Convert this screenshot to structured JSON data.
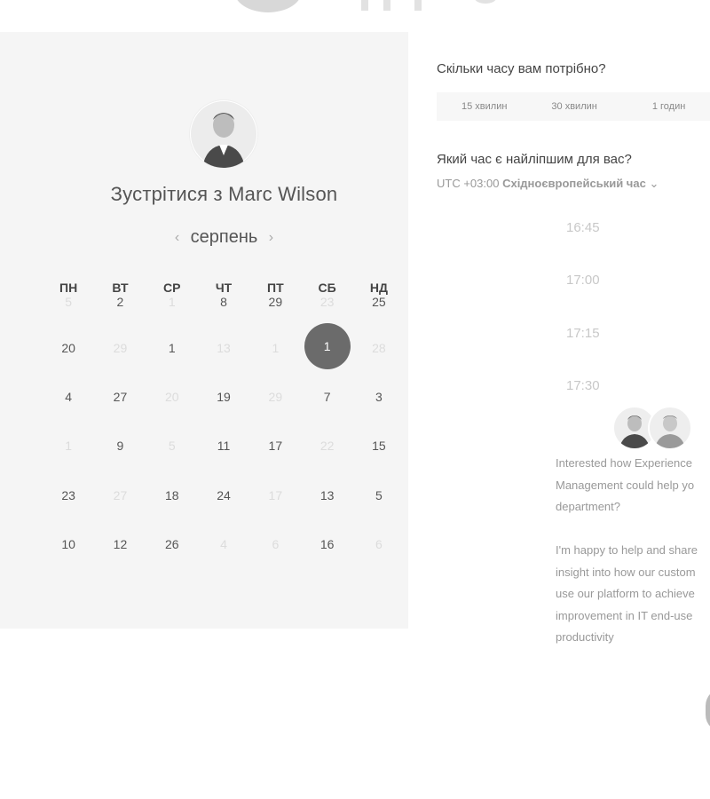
{
  "host": {
    "meet_title": "Зустрітися з Marc Wilson"
  },
  "calendar": {
    "month": "серпень",
    "prev_icon": "chevron-left-icon",
    "next_icon": "chevron-right-icon",
    "weekdays": [
      "ПН",
      "ВТ",
      "СР",
      "ЧТ",
      "ПТ",
      "СБ",
      "НД"
    ],
    "weeks": [
      [
        "5",
        "2",
        "1",
        "8",
        "29",
        "23",
        "25"
      ],
      [
        "20",
        "29",
        "1",
        "13",
        "1",
        "1",
        "28"
      ],
      [
        "4",
        "27",
        "20",
        "19",
        "29",
        "7",
        "3"
      ],
      [
        "1",
        "9",
        "5",
        "11",
        "17",
        "22",
        "15"
      ],
      [
        "23",
        "27",
        "18",
        "24",
        "17",
        "13",
        "5"
      ],
      [
        "10",
        "12",
        "26",
        "4",
        "6",
        "16",
        "6"
      ]
    ]
  },
  "duration": {
    "question": "Скільки часу вам потрібно?",
    "options": [
      "15 хвилин",
      "30 хвилин",
      "1 годин"
    ]
  },
  "time": {
    "question": "Який час є найліпшим для вас?",
    "tz_offset": "UTC +03:00",
    "tz_name": "Східноєвропейський час",
    "tz_chevron": "⌄",
    "slots": [
      "16:45",
      "17:00",
      "17:15",
      "17:30"
    ]
  },
  "chat": {
    "message_1": "Interested how Experience\nManagement could help yo\ndepartment?",
    "message_2": "I'm happy to help and share\ninsight into how our custom\nuse our platform to achieve\nimprovement in IT end-use\nproductivity"
  }
}
